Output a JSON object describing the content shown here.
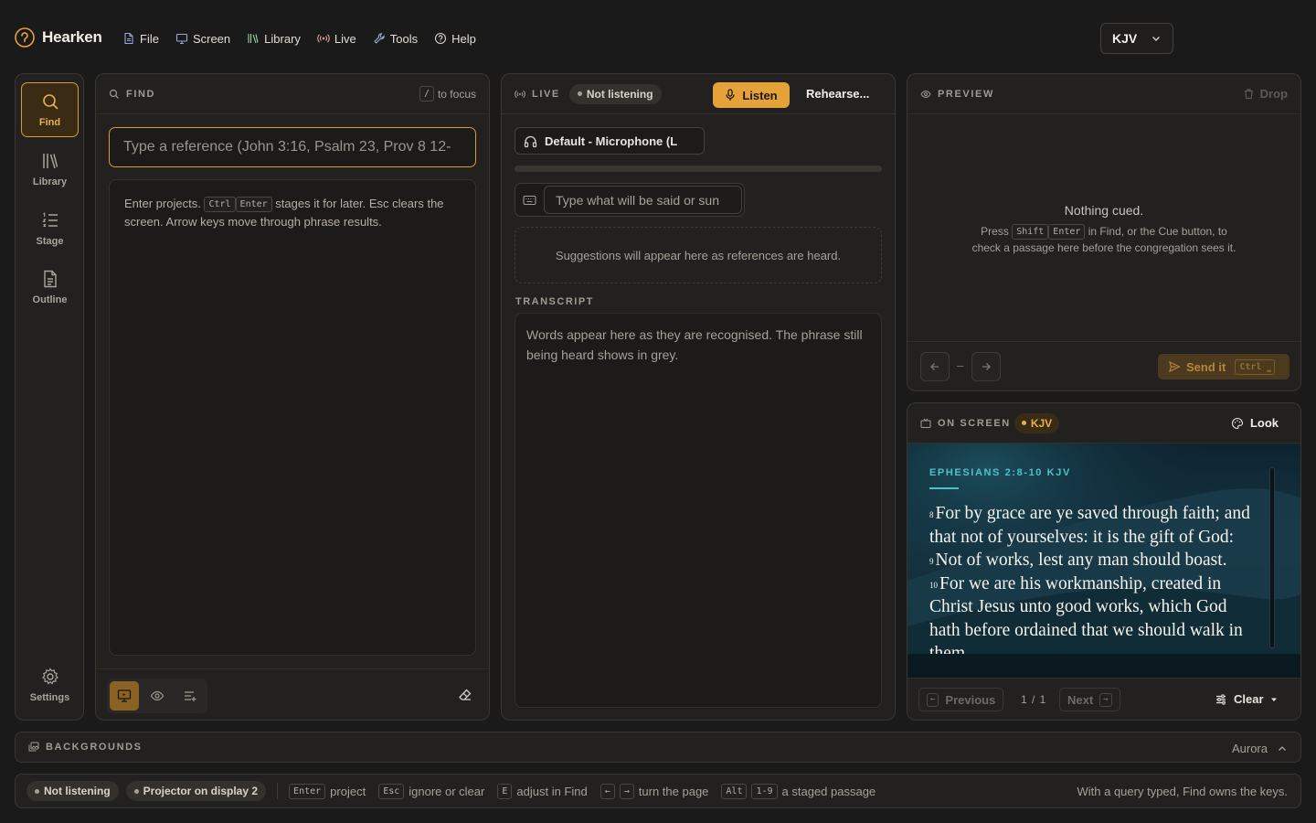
{
  "app": {
    "name": "Hearken"
  },
  "menu": [
    {
      "label": "File",
      "icon": "file-icon"
    },
    {
      "label": "Screen",
      "icon": "monitor-icon"
    },
    {
      "label": "Library",
      "icon": "library-icon"
    },
    {
      "label": "Live",
      "icon": "broadcast-icon"
    },
    {
      "label": "Tools",
      "icon": "wrench-icon"
    },
    {
      "label": "Help",
      "icon": "help-circle-icon"
    }
  ],
  "version_select": {
    "value": "KJV"
  },
  "sidebar": {
    "items": [
      {
        "label": "Find",
        "icon": "search-icon",
        "active": true
      },
      {
        "label": "Library",
        "icon": "library-icon"
      },
      {
        "label": "Stage",
        "icon": "list-ordered-icon"
      },
      {
        "label": "Outline",
        "icon": "document-icon"
      }
    ],
    "settings_label": "Settings"
  },
  "find": {
    "title": "FIND",
    "focus_key": "/",
    "focus_hint": "to focus",
    "placeholder": "Type a reference (John 3:16, Psalm 23, Prov 8 12-",
    "help_start": "Enter projects.",
    "help_key_ctrl": "Ctrl",
    "help_key_enter": "Enter",
    "help_end": "stages it for later. Esc clears the screen. Arrow keys move through phrase results."
  },
  "live": {
    "title": "LIVE",
    "status": "Not listening",
    "listen_label": "Listen",
    "rehearse_label": "Rehearse...",
    "mic_device": "Default - Microphone (L",
    "say_placeholder": "Type what will be said or sun",
    "suggestions_empty": "Suggestions will appear here as references are heard.",
    "transcript_label": "TRANSCRIPT",
    "transcript_empty": "Words appear here as they are recognised. The phrase still being heard shows in grey."
  },
  "preview": {
    "title": "PREVIEW",
    "drop_label": "Drop",
    "empty_title": "Nothing cued.",
    "empty_press": "Press",
    "empty_key_shift": "Shift",
    "empty_key_enter": "Enter",
    "empty_line1_end": "in Find, or the Cue button, to",
    "empty_line2": "check a passage here before the congregation sees it.",
    "position": "–",
    "send_label": "Send it",
    "send_key": "Ctrl ⎵"
  },
  "onscreen": {
    "title": "ON SCREEN",
    "version_badge": "KJV",
    "look_label": "Look",
    "reference": "EPHESIANS 2:8-10 KJV",
    "verses": [
      {
        "num": "8",
        "text": "For by grace are ye saved through faith; and that not of yourselves: it is the gift of God:"
      },
      {
        "num": "9",
        "text": "Not of works, lest any man should boast."
      },
      {
        "num": "10",
        "text": "For we are his workmanship, created in Christ Jesus unto good works, which God hath before ordained that we should walk in them."
      }
    ],
    "prev_label": "Previous",
    "page": "1 / 1",
    "next_label": "Next",
    "clear_label": "Clear"
  },
  "backgrounds": {
    "title": "BACKGROUNDS",
    "current": "Aurora"
  },
  "statusbar": {
    "listening": "Not listening",
    "projector": "Projector on display 2",
    "hints": [
      {
        "keys": [
          "Enter"
        ],
        "text": "project"
      },
      {
        "keys": [
          "Esc"
        ],
        "text": "ignore or clear"
      },
      {
        "keys": [
          "E"
        ],
        "text": "adjust in Find"
      },
      {
        "keys": [
          "←",
          "→"
        ],
        "text": "turn the page"
      },
      {
        "keys": [
          "Alt",
          "1-9"
        ],
        "text": "a staged passage"
      }
    ],
    "right_text": "With a query typed, Find owns the keys."
  },
  "colors": {
    "accent": "#e4a238",
    "teal": "#4fc0c7",
    "background": "#1b1a1a",
    "panel": "#222120"
  }
}
